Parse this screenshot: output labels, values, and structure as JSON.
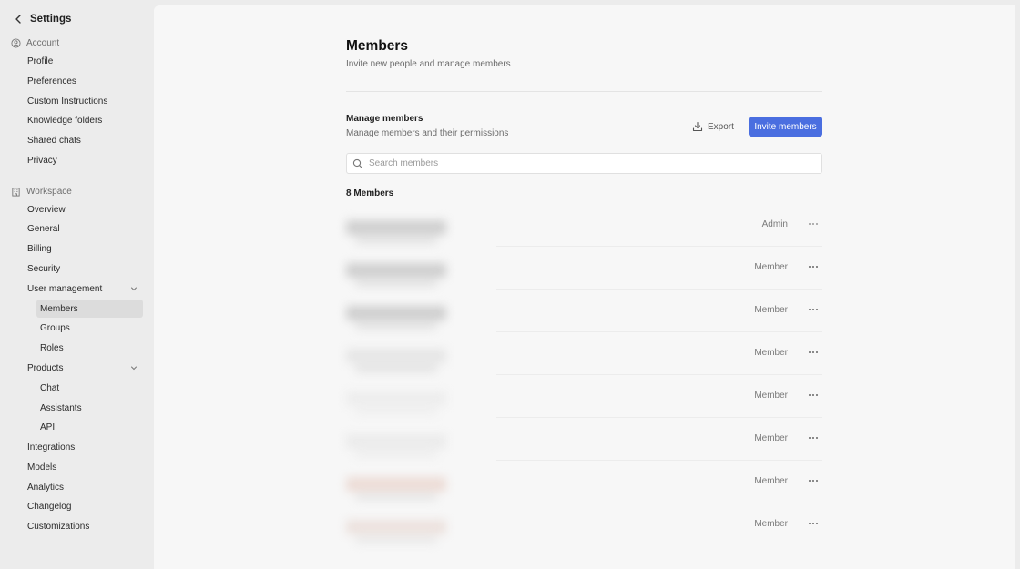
{
  "sidebar": {
    "header_title": "Settings",
    "account_label": "Account",
    "account_items": [
      "Profile",
      "Preferences",
      "Custom Instructions",
      "Knowledge folders",
      "Shared chats",
      "Privacy"
    ],
    "workspace_label": "Workspace",
    "workspace_items": {
      "overview": "Overview",
      "general": "General",
      "billing": "Billing",
      "security": "Security",
      "user_management": "User management",
      "members": "Members",
      "groups": "Groups",
      "roles": "Roles",
      "products": "Products",
      "chat": "Chat",
      "assistants": "Assistants",
      "api": "API",
      "integrations": "Integrations",
      "models": "Models",
      "analytics": "Analytics",
      "changelog": "Changelog",
      "customizations": "Customizations"
    },
    "active_item": "Members"
  },
  "main": {
    "title": "Members",
    "subtitle": "Invite new people and manage members",
    "manage_title": "Manage members",
    "manage_subtitle": "Manage members and their permissions",
    "export_label": "Export",
    "invite_label": "Invite members",
    "search_placeholder": "Search members",
    "count_label": "8 Members",
    "members": [
      {
        "role": "Admin"
      },
      {
        "role": "Member"
      },
      {
        "role": "Member"
      },
      {
        "role": "Member"
      },
      {
        "role": "Member"
      },
      {
        "role": "Member"
      },
      {
        "role": "Member"
      },
      {
        "role": "Member"
      }
    ]
  },
  "colors": {
    "accent": "#4a6ee0",
    "sidebar_bg": "#ececec",
    "main_bg": "#f7f7f7",
    "active_item_bg": "#dcdcdc"
  },
  "icons": {
    "back": "chevron-left-icon",
    "account": "user-circle-icon",
    "workspace": "building-icon",
    "expand": "chevron-down-icon",
    "export": "download-icon",
    "search": "search-icon",
    "more": "more-horizontal-icon"
  }
}
